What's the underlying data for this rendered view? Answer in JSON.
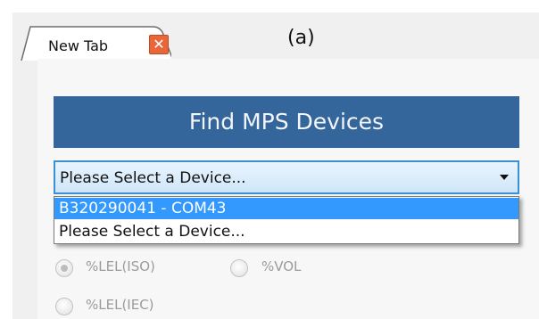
{
  "tab": {
    "label": "New Tab",
    "close_glyph": "✕"
  },
  "figure_label": "(a)",
  "find_button": {
    "label": "Find MPS Devices"
  },
  "device_select": {
    "value": "Please Select a Device...",
    "options": [
      "B320290041 - COM43",
      "Please Select a Device..."
    ],
    "highlighted_index": 0
  },
  "units": {
    "options": [
      {
        "label": "%LEL(ISO)",
        "checked": true
      },
      {
        "label": "%VOL",
        "checked": false
      },
      {
        "label": "%LEL(IEC)",
        "checked": false
      }
    ]
  },
  "colors": {
    "button_bg": "#34659b",
    "highlight": "#3399ff",
    "close_bg": "#e8663a"
  }
}
